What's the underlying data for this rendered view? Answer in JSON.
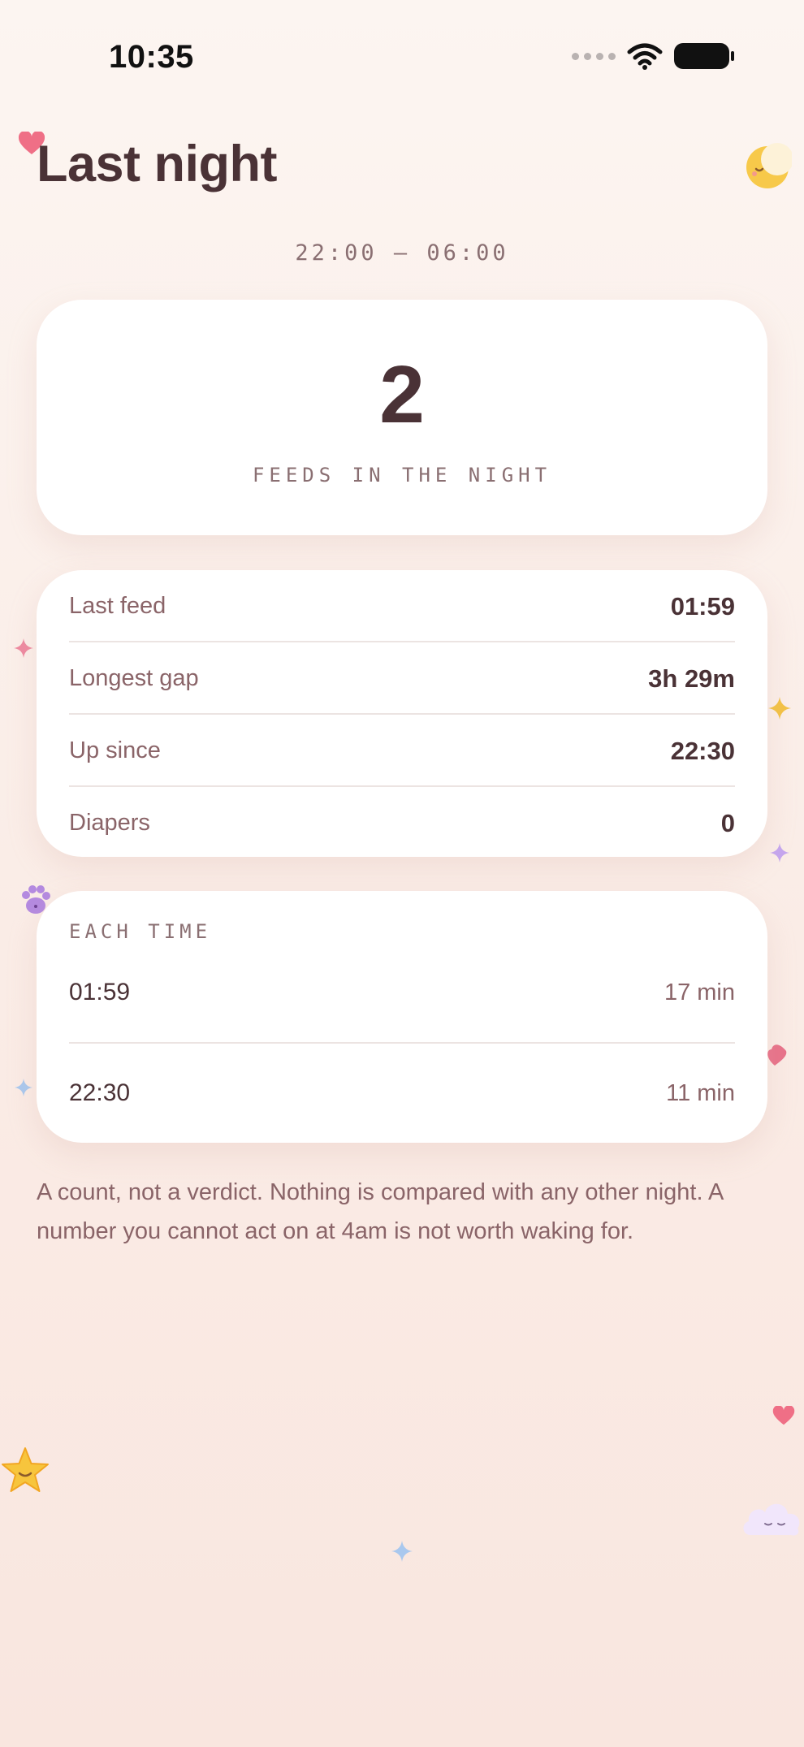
{
  "status_bar": {
    "time": "10:35"
  },
  "header": {
    "title": "Last night"
  },
  "time_range": "22:00 — 06:00",
  "hero": {
    "value": "2",
    "label": "FEEDS IN THE NIGHT"
  },
  "stats": [
    {
      "label": "Last feed",
      "value": "01:59"
    },
    {
      "label": "Longest gap",
      "value": "3h 29m"
    },
    {
      "label": "Up since",
      "value": "22:30"
    },
    {
      "label": "Diapers",
      "value": "0"
    }
  ],
  "each_time": {
    "heading": "EACH TIME",
    "rows": [
      {
        "time": "01:59",
        "duration": "17 min"
      },
      {
        "time": "22:30",
        "duration": "11 min"
      }
    ]
  },
  "footer": "A count, not a verdict. Nothing is compared with any other night. A number you cannot act on at 4am is not worth waking for.",
  "decorations": [
    "heart-icon",
    "moon-icon",
    "paw-icon",
    "star-icon",
    "cloud-icon",
    "sparkle-icon"
  ],
  "colors": {
    "background": "#fcf5f1",
    "text_primary": "#4a3236",
    "text_secondary": "#8a6468",
    "card": "#ffffff",
    "heart": "#ef6f86"
  }
}
